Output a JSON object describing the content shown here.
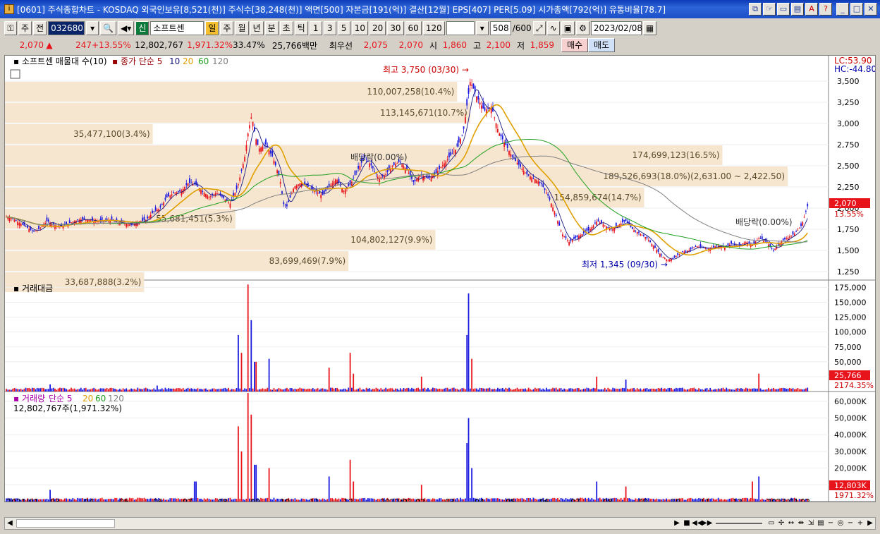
{
  "title": "[0601] 주식종합차트 - KOSDAQ 외국인보유[8,521(천)] 주식수[38,248(천)] 액면[500] 자본금[191(억)] 결산[12월] EPS[407] PER[5.09] 시가총액[792(억)] 유통비율[78.7]",
  "colors": {
    "up": "#e8141c",
    "down": "#1a1ae0",
    "ma5": "#1a1a80",
    "ma20": "#e0a000",
    "ma60": "#20a020",
    "ma120": "#808080",
    "bar": "#f7e6cf"
  },
  "toolbar": {
    "type_select": "주",
    "prev_label": "전",
    "code": "032680",
    "name": "소프트센",
    "periods": [
      "일",
      "주",
      "월",
      "년",
      "분",
      "초",
      "틱"
    ],
    "active_period": "일",
    "numbers": [
      "1",
      "3",
      "5",
      "10",
      "20",
      "30",
      "60",
      "120"
    ],
    "count": "508",
    "count_total": "/600",
    "date": "2023/02/08",
    "new_label": "신"
  },
  "quote": {
    "price": "2,070",
    "change": "247",
    "change_pct": "+13.55%",
    "volume": "12,802,767",
    "volume_pct": "1,971.32%",
    "pct2": "33.47%",
    "amount": "25,766백만",
    "best_label": "최우선",
    "ask": "2,075",
    "bid": "2,070",
    "open_label": "시",
    "open": "1,860",
    "high_label": "고",
    "high": "2,100",
    "low_label": "저",
    "low": "1,859",
    "buy": "매수",
    "sell": "매도"
  },
  "panels": {
    "price_legend": "소프트센 매물대 수(10)",
    "price_ma_label": "종가 단순 5",
    "ma": [
      "5",
      "10",
      "20",
      "60",
      "120"
    ],
    "value_title": "거래대금",
    "vol_title": "거래량",
    "vol_ma_label": "단순 5",
    "vol_ma": [
      "20",
      "60",
      "120"
    ],
    "vol_info": "12,802,767주(1,971.32%)",
    "lc": "LC:53.90",
    "hc": "HC:-44.80",
    "annot_high": "최고 3,750 (03/30)",
    "annot_low": "최저 1,345 (09/30)",
    "dividend1": "배당락(0.00%)",
    "dividend2": "배당락(0.00%)",
    "price_tag": "2,070",
    "price_tag_pct": "13.55%",
    "value_tag": "25,766",
    "value_tag_pct": "2174.35%",
    "vol_tag": "12,803K",
    "vol_tag_pct": "1971.32%"
  },
  "volume_profile": [
    {
      "label": "110,007,258(10.4%)",
      "low": 3250,
      "high": 3500
    },
    {
      "label": "113,145,671(10.7%)",
      "low": 3000,
      "high": 3250
    },
    {
      "label": "35,477,100(3.4%)",
      "low": 2750,
      "high": 3000
    },
    {
      "label": "174,699,123(16.5%)",
      "low": 2500,
      "high": 2750
    },
    {
      "label": "189,526,693(18.0%)(2,631.00 ~ 2,422.50)",
      "low": 2250,
      "high": 2500
    },
    {
      "label": "154,859,674(14.7%)",
      "low": 2000,
      "high": 2250
    },
    {
      "label": "55,681,451(5.3%)",
      "low": 1750,
      "high": 2000
    },
    {
      "label": "104,802,127(9.9%)",
      "low": 1500,
      "high": 1750
    },
    {
      "label": "83,699,469(7.9%)",
      "low": 1250,
      "high": 1500
    },
    {
      "label": "33,687,888(3.2%)",
      "low": 1000,
      "high": 1250
    }
  ],
  "chart_data": [
    {
      "type": "candlestick",
      "title": "소프트센",
      "yticks": [
        1250,
        1500,
        1750,
        2000,
        2250,
        2500,
        2750,
        3000,
        3250,
        3500
      ],
      "ylim": [
        1150,
        3800
      ],
      "xlabels": [
        "2021/01",
        "03",
        "04",
        "05",
        "06",
        "07",
        "08",
        "09",
        "10",
        "11",
        "12",
        "2022/01",
        "02",
        "03",
        "04",
        "05",
        "06",
        "07",
        "08",
        "09",
        "10",
        "11",
        "12",
        "2023/01",
        "02"
      ],
      "close_path": [
        [
          0,
          1900
        ],
        [
          10,
          1880
        ],
        [
          20,
          1830
        ],
        [
          30,
          1780
        ],
        [
          40,
          1720
        ],
        [
          50,
          1760
        ],
        [
          60,
          1850
        ],
        [
          70,
          1800
        ],
        [
          80,
          1780
        ],
        [
          90,
          1820
        ],
        [
          100,
          1850
        ],
        [
          110,
          1870
        ],
        [
          120,
          1860
        ],
        [
          130,
          1840
        ],
        [
          140,
          1850
        ],
        [
          150,
          1860
        ],
        [
          160,
          1830
        ],
        [
          170,
          1820
        ],
        [
          180,
          1800
        ],
        [
          190,
          1840
        ],
        [
          200,
          1860
        ],
        [
          210,
          1950
        ],
        [
          220,
          2000
        ],
        [
          230,
          2130
        ],
        [
          240,
          2180
        ],
        [
          250,
          2200
        ],
        [
          260,
          2300
        ],
        [
          270,
          2280
        ],
        [
          280,
          2200
        ],
        [
          290,
          2130
        ],
        [
          300,
          2180
        ],
        [
          310,
          2120
        ],
        [
          320,
          2050
        ],
        [
          330,
          2250
        ],
        [
          340,
          2600
        ],
        [
          345,
          2900
        ],
        [
          350,
          3100
        ],
        [
          355,
          2850
        ],
        [
          360,
          2700
        ],
        [
          370,
          2750
        ],
        [
          380,
          2600
        ],
        [
          390,
          2350
        ],
        [
          395,
          2050
        ],
        [
          400,
          2020
        ],
        [
          410,
          2250
        ],
        [
          420,
          2300
        ],
        [
          430,
          2250
        ],
        [
          440,
          2200
        ],
        [
          450,
          2150
        ],
        [
          460,
          2250
        ],
        [
          470,
          2350
        ],
        [
          480,
          2200
        ],
        [
          490,
          2280
        ],
        [
          500,
          2450
        ],
        [
          510,
          2600
        ],
        [
          520,
          2500
        ],
        [
          530,
          2350
        ],
        [
          540,
          2400
        ],
        [
          550,
          2500
        ],
        [
          560,
          2550
        ],
        [
          570,
          2450
        ],
        [
          580,
          2300
        ],
        [
          590,
          2400
        ],
        [
          600,
          2350
        ],
        [
          610,
          2400
        ],
        [
          620,
          2500
        ],
        [
          630,
          2600
        ],
        [
          640,
          2700
        ],
        [
          650,
          2900
        ],
        [
          655,
          3200
        ],
        [
          660,
          3500
        ],
        [
          670,
          3300
        ],
        [
          680,
          3150
        ],
        [
          690,
          3200
        ],
        [
          700,
          2900
        ],
        [
          710,
          2750
        ],
        [
          720,
          2600
        ],
        [
          730,
          2500
        ],
        [
          740,
          2400
        ],
        [
          750,
          2350
        ],
        [
          760,
          2300
        ],
        [
          770,
          2150
        ],
        [
          780,
          1950
        ],
        [
          790,
          1700
        ],
        [
          800,
          1600
        ],
        [
          810,
          1650
        ],
        [
          820,
          1700
        ],
        [
          830,
          1750
        ],
        [
          840,
          1850
        ],
        [
          850,
          1800
        ],
        [
          860,
          1750
        ],
        [
          870,
          1800
        ],
        [
          880,
          1850
        ],
        [
          890,
          1750
        ],
        [
          900,
          1700
        ],
        [
          910,
          1650
        ],
        [
          920,
          1550
        ],
        [
          930,
          1450
        ],
        [
          940,
          1380
        ],
        [
          950,
          1420
        ],
        [
          960,
          1480
        ],
        [
          970,
          1500
        ],
        [
          980,
          1550
        ],
        [
          990,
          1530
        ],
        [
          1000,
          1520
        ],
        [
          1010,
          1560
        ],
        [
          1020,
          1540
        ],
        [
          1030,
          1580
        ],
        [
          1040,
          1550
        ],
        [
          1050,
          1600
        ],
        [
          1060,
          1570
        ],
        [
          1070,
          1650
        ],
        [
          1080,
          1600
        ],
        [
          1090,
          1500
        ],
        [
          1100,
          1600
        ],
        [
          1110,
          1650
        ],
        [
          1120,
          1700
        ],
        [
          1130,
          1800
        ],
        [
          1140,
          2070
        ]
      ]
    },
    {
      "type": "bar",
      "title": "거래대금",
      "yticks": [
        "25,000",
        "50,000",
        "75,000",
        "100,000",
        "125,000",
        "150,000",
        "175,000"
      ],
      "ylim": [
        0,
        185000
      ],
      "spikes": [
        [
          65,
          12000
        ],
        [
          215,
          10000
        ],
        [
          330,
          95000
        ],
        [
          335,
          65000
        ],
        [
          345,
          180000
        ],
        [
          350,
          120000
        ],
        [
          355,
          50000
        ],
        [
          375,
          55000
        ],
        [
          460,
          40000
        ],
        [
          490,
          65000
        ],
        [
          495,
          30000
        ],
        [
          590,
          25000
        ],
        [
          655,
          95000
        ],
        [
          658,
          165000
        ],
        [
          662,
          55000
        ],
        [
          840,
          25000
        ],
        [
          880,
          20000
        ],
        [
          1070,
          30000
        ],
        [
          1140,
          25766
        ]
      ]
    },
    {
      "type": "bar",
      "title": "거래량",
      "yticks": [
        "10,000K",
        "20,000K",
        "30,000K",
        "40,000K",
        "50,000K",
        "60,000K"
      ],
      "ylim": [
        0,
        65000
      ],
      "spikes": [
        [
          65,
          7000
        ],
        [
          270,
          12000
        ],
        [
          330,
          45000
        ],
        [
          335,
          30000
        ],
        [
          345,
          65000
        ],
        [
          350,
          52000
        ],
        [
          355,
          22000
        ],
        [
          375,
          20000
        ],
        [
          460,
          15000
        ],
        [
          490,
          25000
        ],
        [
          495,
          12000
        ],
        [
          590,
          10000
        ],
        [
          655,
          35000
        ],
        [
          658,
          50000
        ],
        [
          662,
          20000
        ],
        [
          840,
          12000
        ],
        [
          880,
          9000
        ],
        [
          1060,
          12000
        ],
        [
          1070,
          15000
        ],
        [
          1140,
          12803
        ]
      ]
    }
  ]
}
